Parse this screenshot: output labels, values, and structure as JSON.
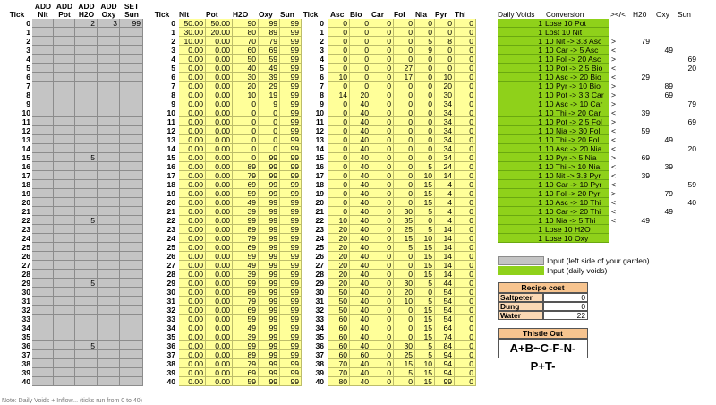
{
  "headers": {
    "tick": "Tick",
    "add_nit": [
      "ADD",
      "Nit"
    ],
    "add_pot": [
      "ADD",
      "Pot"
    ],
    "add_h2o": [
      "ADD",
      "H2O"
    ],
    "add_oxy": [
      "ADD",
      "Oxy"
    ],
    "set_sun": [
      "SET",
      "Sun"
    ],
    "tick2": "Tick",
    "nit": "Nit",
    "pot": "Pot",
    "h2o": "H2O",
    "oxy": "Oxy",
    "sun": "Sun",
    "tick3": "Tick",
    "asc": "Asc",
    "bio": "Bio",
    "car": "Car",
    "fol": "Fol",
    "nia": "Nia",
    "pyr": "Pyr",
    "thi": "Thi",
    "daily_voids": "Daily Voids",
    "conversion": "Conversion",
    "cmp": "></<",
    "h2o_r": "H20",
    "oxy_r": "Oxy",
    "sun_r": "Sun"
  },
  "input_rows": {
    "0": [
      "",
      "",
      "2",
      "3",
      "99"
    ],
    "15": [
      "",
      "",
      "5",
      "",
      ""
    ],
    "22": [
      "",
      "",
      "5",
      "",
      ""
    ],
    "29": [
      "",
      "",
      "5",
      "",
      ""
    ],
    "36": [
      "",
      "",
      "5",
      "",
      ""
    ]
  },
  "state_rows": [
    [
      "50.00",
      "50.00",
      "90",
      "99",
      "99"
    ],
    [
      "30.00",
      "20.00",
      "80",
      "89",
      "99"
    ],
    [
      "10.00",
      "0.00",
      "70",
      "79",
      "99"
    ],
    [
      "0.00",
      "0.00",
      "60",
      "69",
      "99"
    ],
    [
      "0.00",
      "0.00",
      "50",
      "59",
      "99"
    ],
    [
      "0.00",
      "0.00",
      "40",
      "49",
      "99"
    ],
    [
      "0.00",
      "0.00",
      "30",
      "39",
      "99"
    ],
    [
      "0.00",
      "0.00",
      "20",
      "29",
      "99"
    ],
    [
      "0.00",
      "0.00",
      "10",
      "19",
      "99"
    ],
    [
      "0.00",
      "0.00",
      "0",
      "9",
      "99"
    ],
    [
      "0.00",
      "0.00",
      "0",
      "0",
      "99"
    ],
    [
      "0.00",
      "0.00",
      "0",
      "0",
      "99"
    ],
    [
      "0.00",
      "0.00",
      "0",
      "0",
      "99"
    ],
    [
      "0.00",
      "0.00",
      "0",
      "0",
      "99"
    ],
    [
      "0.00",
      "0.00",
      "0",
      "0",
      "99"
    ],
    [
      "0.00",
      "0.00",
      "0",
      "99",
      "99"
    ],
    [
      "0.00",
      "0.00",
      "89",
      "99",
      "99"
    ],
    [
      "0.00",
      "0.00",
      "79",
      "99",
      "99"
    ],
    [
      "0.00",
      "0.00",
      "69",
      "99",
      "99"
    ],
    [
      "0.00",
      "0.00",
      "59",
      "99",
      "99"
    ],
    [
      "0.00",
      "0.00",
      "49",
      "99",
      "99"
    ],
    [
      "0.00",
      "0.00",
      "39",
      "99",
      "99"
    ],
    [
      "0.00",
      "0.00",
      "99",
      "99",
      "99"
    ],
    [
      "0.00",
      "0.00",
      "89",
      "99",
      "99"
    ],
    [
      "0.00",
      "0.00",
      "79",
      "99",
      "99"
    ],
    [
      "0.00",
      "0.00",
      "69",
      "99",
      "99"
    ],
    [
      "0.00",
      "0.00",
      "59",
      "99",
      "99"
    ],
    [
      "0.00",
      "0.00",
      "49",
      "99",
      "99"
    ],
    [
      "0.00",
      "0.00",
      "39",
      "99",
      "99"
    ],
    [
      "0.00",
      "0.00",
      "99",
      "99",
      "99"
    ],
    [
      "0.00",
      "0.00",
      "89",
      "99",
      "99"
    ],
    [
      "0.00",
      "0.00",
      "79",
      "99",
      "99"
    ],
    [
      "0.00",
      "0.00",
      "69",
      "99",
      "99"
    ],
    [
      "0.00",
      "0.00",
      "59",
      "99",
      "99"
    ],
    [
      "0.00",
      "0.00",
      "49",
      "99",
      "99"
    ],
    [
      "0.00",
      "0.00",
      "39",
      "99",
      "99"
    ],
    [
      "0.00",
      "0.00",
      "99",
      "99",
      "99"
    ],
    [
      "0.00",
      "0.00",
      "89",
      "99",
      "99"
    ],
    [
      "0.00",
      "0.00",
      "79",
      "99",
      "99"
    ],
    [
      "0.00",
      "0.00",
      "69",
      "99",
      "99"
    ],
    [
      "0.00",
      "0.00",
      "59",
      "99",
      "99"
    ]
  ],
  "vitamin_rows": [
    [
      "0",
      "0",
      "0",
      "0",
      "0",
      "0",
      "0"
    ],
    [
      "0",
      "0",
      "0",
      "0",
      "0",
      "0",
      "0"
    ],
    [
      "0",
      "0",
      "0",
      "0",
      "5",
      "8",
      "0"
    ],
    [
      "0",
      "0",
      "0",
      "0",
      "9",
      "0",
      "0"
    ],
    [
      "0",
      "0",
      "0",
      "0",
      "0",
      "0",
      "0"
    ],
    [
      "0",
      "0",
      "0",
      "27",
      "0",
      "0",
      "0"
    ],
    [
      "10",
      "0",
      "0",
      "17",
      "0",
      "10",
      "0"
    ],
    [
      "0",
      "0",
      "0",
      "0",
      "0",
      "20",
      "0"
    ],
    [
      "14",
      "20",
      "0",
      "0",
      "0",
      "30",
      "0"
    ],
    [
      "0",
      "40",
      "0",
      "0",
      "0",
      "34",
      "0"
    ],
    [
      "0",
      "40",
      "0",
      "0",
      "0",
      "34",
      "0"
    ],
    [
      "0",
      "40",
      "0",
      "0",
      "0",
      "34",
      "0"
    ],
    [
      "0",
      "40",
      "0",
      "0",
      "0",
      "34",
      "0"
    ],
    [
      "0",
      "40",
      "0",
      "0",
      "0",
      "34",
      "0"
    ],
    [
      "0",
      "40",
      "0",
      "0",
      "0",
      "34",
      "0"
    ],
    [
      "0",
      "40",
      "0",
      "0",
      "0",
      "34",
      "0"
    ],
    [
      "0",
      "40",
      "0",
      "0",
      "5",
      "24",
      "0"
    ],
    [
      "0",
      "40",
      "0",
      "0",
      "10",
      "14",
      "0"
    ],
    [
      "0",
      "40",
      "0",
      "0",
      "15",
      "4",
      "0"
    ],
    [
      "0",
      "40",
      "0",
      "0",
      "15",
      "4",
      "0"
    ],
    [
      "0",
      "40",
      "0",
      "0",
      "15",
      "4",
      "0"
    ],
    [
      "0",
      "40",
      "0",
      "30",
      "5",
      "4",
      "0"
    ],
    [
      "10",
      "40",
      "0",
      "35",
      "0",
      "4",
      "0"
    ],
    [
      "20",
      "40",
      "0",
      "25",
      "5",
      "14",
      "0"
    ],
    [
      "20",
      "40",
      "0",
      "15",
      "10",
      "14",
      "0"
    ],
    [
      "20",
      "40",
      "0",
      "5",
      "15",
      "14",
      "0"
    ],
    [
      "20",
      "40",
      "0",
      "0",
      "15",
      "14",
      "0"
    ],
    [
      "20",
      "40",
      "0",
      "0",
      "15",
      "14",
      "0"
    ],
    [
      "20",
      "40",
      "0",
      "0",
      "15",
      "14",
      "0"
    ],
    [
      "20",
      "40",
      "0",
      "30",
      "5",
      "44",
      "0"
    ],
    [
      "50",
      "40",
      "0",
      "20",
      "0",
      "54",
      "0"
    ],
    [
      "50",
      "40",
      "0",
      "10",
      "5",
      "54",
      "0"
    ],
    [
      "50",
      "40",
      "0",
      "0",
      "15",
      "54",
      "0"
    ],
    [
      "60",
      "40",
      "0",
      "0",
      "15",
      "54",
      "0"
    ],
    [
      "60",
      "40",
      "0",
      "0",
      "15",
      "64",
      "0"
    ],
    [
      "60",
      "40",
      "0",
      "0",
      "15",
      "74",
      "0"
    ],
    [
      "60",
      "40",
      "0",
      "30",
      "5",
      "84",
      "0"
    ],
    [
      "60",
      "60",
      "0",
      "25",
      "5",
      "94",
      "0"
    ],
    [
      "70",
      "40",
      "0",
      "15",
      "10",
      "94",
      "0"
    ],
    [
      "70",
      "40",
      "0",
      "5",
      "15",
      "94",
      "0"
    ],
    [
      "80",
      "40",
      "0",
      "0",
      "15",
      "99",
      "0"
    ]
  ],
  "voids": [
    {
      "n": "1",
      "text": "Lose 10 Pot",
      "cmp": "",
      "h2o": "",
      "oxy": "",
      "sun": ""
    },
    {
      "n": "1",
      "text": "Lost 10 Nit",
      "cmp": "",
      "h2o": "",
      "oxy": "",
      "sun": ""
    },
    {
      "n": "1",
      "text": "10 Nit -> 3.3 Asc",
      "cmp": ">",
      "h2o": "79",
      "oxy": "",
      "sun": ""
    },
    {
      "n": "1",
      "text": "10 Car -> 5 Asc",
      "cmp": "<",
      "h2o": "",
      "oxy": "49",
      "sun": ""
    },
    {
      "n": "1",
      "text": "10 Fol -> 20 Asc",
      "cmp": ">",
      "h2o": "",
      "oxy": "",
      "sun": "69"
    },
    {
      "n": "1",
      "text": "10 Pot -> 2.5 Bio",
      "cmp": "<",
      "h2o": "",
      "oxy": "",
      "sun": "20"
    },
    {
      "n": "1",
      "text": "10 Asc -> 20 Bio",
      "cmp": "<",
      "h2o": "29",
      "oxy": "",
      "sun": ""
    },
    {
      "n": "1",
      "text": "10 Pyr -> 10 Bio",
      "cmp": ">",
      "h2o": "",
      "oxy": "89",
      "sun": ""
    },
    {
      "n": "1",
      "text": "10 Pot -> 3.3 Car",
      "cmp": ">",
      "h2o": "",
      "oxy": "69",
      "sun": ""
    },
    {
      "n": "1",
      "text": "10 Asc -> 10 Car",
      "cmp": ">",
      "h2o": "",
      "oxy": "",
      "sun": "79"
    },
    {
      "n": "1",
      "text": "10 Thi -> 20 Car",
      "cmp": "<",
      "h2o": "39",
      "oxy": "",
      "sun": ""
    },
    {
      "n": "1",
      "text": "10 Pot -> 2.5 Fol",
      "cmp": ">",
      "h2o": "",
      "oxy": "",
      "sun": "69"
    },
    {
      "n": "1",
      "text": "10 Nia -> 30 Fol",
      "cmp": "<",
      "h2o": "59",
      "oxy": "",
      "sun": ""
    },
    {
      "n": "1",
      "text": "10 Thi -> 20 Fol",
      "cmp": "<",
      "h2o": "",
      "oxy": "49",
      "sun": ""
    },
    {
      "n": "1",
      "text": "10 Asc -> 20 Nia",
      "cmp": "<",
      "h2o": "",
      "oxy": "",
      "sun": "20"
    },
    {
      "n": "1",
      "text": "10 Pyr -> 5 Nia",
      "cmp": ">",
      "h2o": "69",
      "oxy": "",
      "sun": ""
    },
    {
      "n": "1",
      "text": "10 Thi -> 10 Nia",
      "cmp": "<",
      "h2o": "",
      "oxy": "39",
      "sun": ""
    },
    {
      "n": "1",
      "text": "10 Nit -> 3.3 Pyr",
      "cmp": "<",
      "h2o": "39",
      "oxy": "",
      "sun": ""
    },
    {
      "n": "1",
      "text": "10 Car -> 10 Pyr",
      "cmp": "<",
      "h2o": "",
      "oxy": "",
      "sun": "59"
    },
    {
      "n": "1",
      "text": "10 Fol -> 20 Pyr",
      "cmp": ">",
      "h2o": "",
      "oxy": "79",
      "sun": ""
    },
    {
      "n": "1",
      "text": "10 Asc -> 10 Thi",
      "cmp": "<",
      "h2o": "",
      "oxy": "",
      "sun": "40"
    },
    {
      "n": "1",
      "text": "10 Car -> 20 Thi",
      "cmp": "<",
      "h2o": "",
      "oxy": "49",
      "sun": ""
    },
    {
      "n": "1",
      "text": "10 Nia -> 5 Thi",
      "cmp": "<",
      "h2o": "49",
      "oxy": "",
      "sun": ""
    },
    {
      "n": "1",
      "text": "Lose 10 H2O",
      "cmp": "",
      "h2o": "",
      "oxy": "",
      "sun": ""
    },
    {
      "n": "1",
      "text": "Lose 10 Oxy",
      "cmp": "",
      "h2o": "",
      "oxy": "",
      "sun": ""
    }
  ],
  "legend": {
    "input_gray": "Input (left side of your garden)",
    "input_green": "Input (daily voids)"
  },
  "recipe": {
    "title": "Recipe cost",
    "rows": [
      {
        "label": "Saltpeter",
        "value": "0"
      },
      {
        "label": "Dung",
        "value": "0"
      },
      {
        "label": "Water",
        "value": "22"
      }
    ]
  },
  "thistle": {
    "title": "Thistle Out",
    "value": "A+B~C-F-N-P+T-"
  },
  "footnote": "Note: Daily Voids + Inflow... (ticks run from 0 to 40)",
  "colors": {
    "gray_input": "#c4c4c4",
    "yellow_cells": "#ffff99",
    "green_voids": "#8fd11a",
    "panel_title": "#f7c48f"
  }
}
